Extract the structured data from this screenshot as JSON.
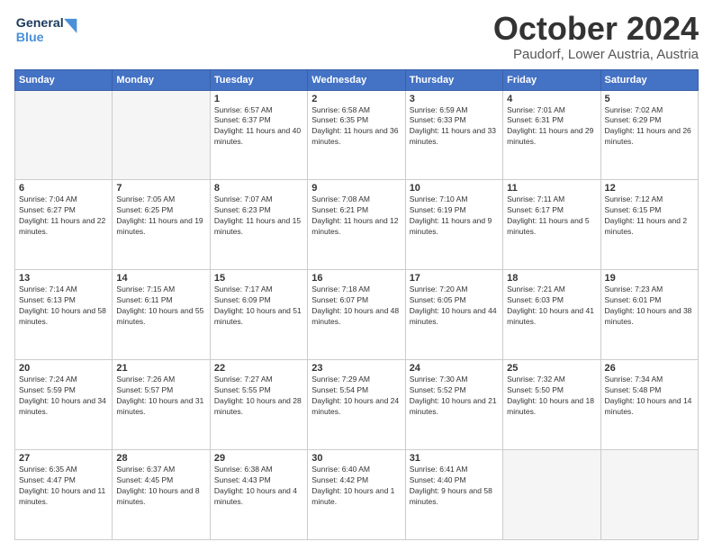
{
  "header": {
    "logo_line1": "General",
    "logo_line2": "Blue",
    "month": "October 2024",
    "location": "Paudorf, Lower Austria, Austria"
  },
  "weekdays": [
    "Sunday",
    "Monday",
    "Tuesday",
    "Wednesday",
    "Thursday",
    "Friday",
    "Saturday"
  ],
  "weeks": [
    [
      {
        "day": "",
        "info": ""
      },
      {
        "day": "",
        "info": ""
      },
      {
        "day": "1",
        "info": "Sunrise: 6:57 AM\nSunset: 6:37 PM\nDaylight: 11 hours and 40 minutes."
      },
      {
        "day": "2",
        "info": "Sunrise: 6:58 AM\nSunset: 6:35 PM\nDaylight: 11 hours and 36 minutes."
      },
      {
        "day": "3",
        "info": "Sunrise: 6:59 AM\nSunset: 6:33 PM\nDaylight: 11 hours and 33 minutes."
      },
      {
        "day": "4",
        "info": "Sunrise: 7:01 AM\nSunset: 6:31 PM\nDaylight: 11 hours and 29 minutes."
      },
      {
        "day": "5",
        "info": "Sunrise: 7:02 AM\nSunset: 6:29 PM\nDaylight: 11 hours and 26 minutes."
      }
    ],
    [
      {
        "day": "6",
        "info": "Sunrise: 7:04 AM\nSunset: 6:27 PM\nDaylight: 11 hours and 22 minutes."
      },
      {
        "day": "7",
        "info": "Sunrise: 7:05 AM\nSunset: 6:25 PM\nDaylight: 11 hours and 19 minutes."
      },
      {
        "day": "8",
        "info": "Sunrise: 7:07 AM\nSunset: 6:23 PM\nDaylight: 11 hours and 15 minutes."
      },
      {
        "day": "9",
        "info": "Sunrise: 7:08 AM\nSunset: 6:21 PM\nDaylight: 11 hours and 12 minutes."
      },
      {
        "day": "10",
        "info": "Sunrise: 7:10 AM\nSunset: 6:19 PM\nDaylight: 11 hours and 9 minutes."
      },
      {
        "day": "11",
        "info": "Sunrise: 7:11 AM\nSunset: 6:17 PM\nDaylight: 11 hours and 5 minutes."
      },
      {
        "day": "12",
        "info": "Sunrise: 7:12 AM\nSunset: 6:15 PM\nDaylight: 11 hours and 2 minutes."
      }
    ],
    [
      {
        "day": "13",
        "info": "Sunrise: 7:14 AM\nSunset: 6:13 PM\nDaylight: 10 hours and 58 minutes."
      },
      {
        "day": "14",
        "info": "Sunrise: 7:15 AM\nSunset: 6:11 PM\nDaylight: 10 hours and 55 minutes."
      },
      {
        "day": "15",
        "info": "Sunrise: 7:17 AM\nSunset: 6:09 PM\nDaylight: 10 hours and 51 minutes."
      },
      {
        "day": "16",
        "info": "Sunrise: 7:18 AM\nSunset: 6:07 PM\nDaylight: 10 hours and 48 minutes."
      },
      {
        "day": "17",
        "info": "Sunrise: 7:20 AM\nSunset: 6:05 PM\nDaylight: 10 hours and 44 minutes."
      },
      {
        "day": "18",
        "info": "Sunrise: 7:21 AM\nSunset: 6:03 PM\nDaylight: 10 hours and 41 minutes."
      },
      {
        "day": "19",
        "info": "Sunrise: 7:23 AM\nSunset: 6:01 PM\nDaylight: 10 hours and 38 minutes."
      }
    ],
    [
      {
        "day": "20",
        "info": "Sunrise: 7:24 AM\nSunset: 5:59 PM\nDaylight: 10 hours and 34 minutes."
      },
      {
        "day": "21",
        "info": "Sunrise: 7:26 AM\nSunset: 5:57 PM\nDaylight: 10 hours and 31 minutes."
      },
      {
        "day": "22",
        "info": "Sunrise: 7:27 AM\nSunset: 5:55 PM\nDaylight: 10 hours and 28 minutes."
      },
      {
        "day": "23",
        "info": "Sunrise: 7:29 AM\nSunset: 5:54 PM\nDaylight: 10 hours and 24 minutes."
      },
      {
        "day": "24",
        "info": "Sunrise: 7:30 AM\nSunset: 5:52 PM\nDaylight: 10 hours and 21 minutes."
      },
      {
        "day": "25",
        "info": "Sunrise: 7:32 AM\nSunset: 5:50 PM\nDaylight: 10 hours and 18 minutes."
      },
      {
        "day": "26",
        "info": "Sunrise: 7:34 AM\nSunset: 5:48 PM\nDaylight: 10 hours and 14 minutes."
      }
    ],
    [
      {
        "day": "27",
        "info": "Sunrise: 6:35 AM\nSunset: 4:47 PM\nDaylight: 10 hours and 11 minutes."
      },
      {
        "day": "28",
        "info": "Sunrise: 6:37 AM\nSunset: 4:45 PM\nDaylight: 10 hours and 8 minutes."
      },
      {
        "day": "29",
        "info": "Sunrise: 6:38 AM\nSunset: 4:43 PM\nDaylight: 10 hours and 4 minutes."
      },
      {
        "day": "30",
        "info": "Sunrise: 6:40 AM\nSunset: 4:42 PM\nDaylight: 10 hours and 1 minute."
      },
      {
        "day": "31",
        "info": "Sunrise: 6:41 AM\nSunset: 4:40 PM\nDaylight: 9 hours and 58 minutes."
      },
      {
        "day": "",
        "info": ""
      },
      {
        "day": "",
        "info": ""
      }
    ]
  ]
}
